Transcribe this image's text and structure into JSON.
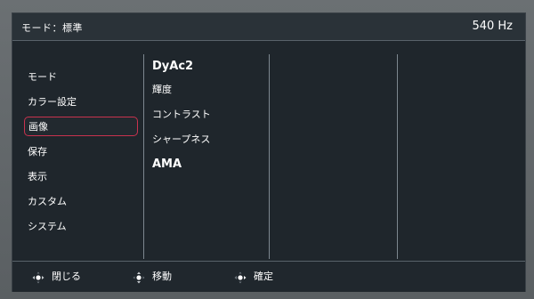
{
  "header": {
    "mode_label": "モード：標準",
    "refresh_rate": "540 Hz"
  },
  "main_menu": {
    "items": [
      {
        "label": "モード"
      },
      {
        "label": "カラー設定"
      },
      {
        "label": "画像"
      },
      {
        "label": "保存"
      },
      {
        "label": "表示"
      },
      {
        "label": "カスタム"
      },
      {
        "label": "システム"
      }
    ],
    "selected": "画像"
  },
  "sub_menu": {
    "items": [
      {
        "label": "DyAc2"
      },
      {
        "label": "輝度"
      },
      {
        "label": "コントラスト"
      },
      {
        "label": "シャープネス"
      },
      {
        "label": "AMA"
      }
    ]
  },
  "footer": {
    "hints": [
      {
        "icon": "dpad-left-right-icon",
        "label": "閉じる"
      },
      {
        "icon": "dpad-up-down-icon",
        "label": "移動"
      },
      {
        "icon": "dpad-right-icon",
        "label": "確定"
      }
    ]
  },
  "colors": {
    "panel_bg": "#1f262c",
    "selection_border": "#c8324e",
    "divider": "#7d8790"
  }
}
